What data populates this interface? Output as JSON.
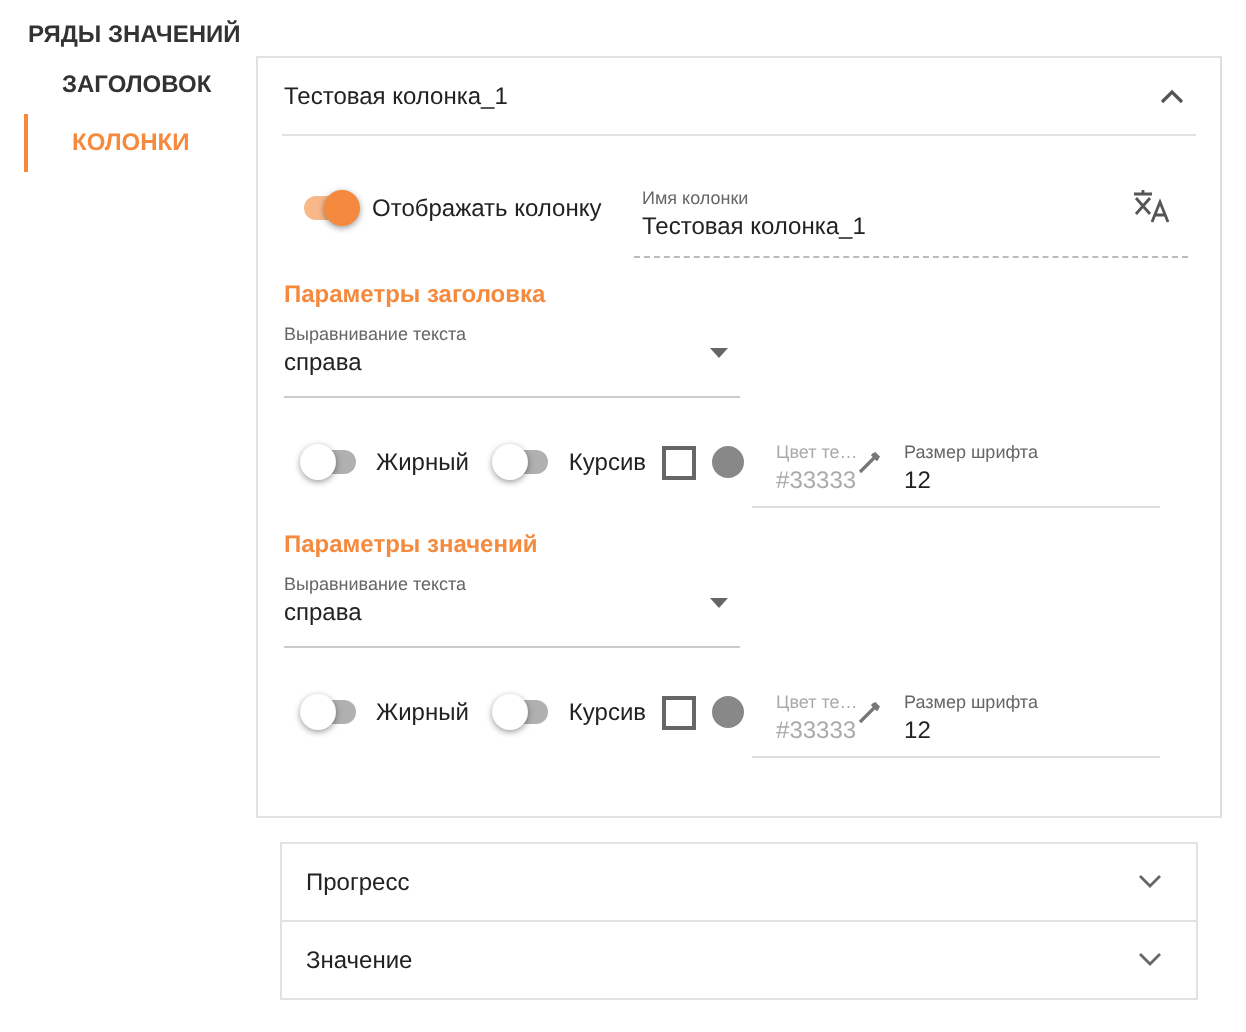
{
  "sidebar": {
    "title": "РЯДЫ ЗНАЧЕНИЙ",
    "items": [
      {
        "label": "ЗАГОЛОВОК",
        "selected": false
      },
      {
        "label": "КОЛОНКИ",
        "selected": true
      }
    ]
  },
  "column_panel": {
    "title": "Тестовая колонка_1",
    "expanded": true,
    "show_column": {
      "label": "Отображать колонку",
      "on": true
    },
    "name_field": {
      "label": "Имя колонки",
      "value": "Тестовая колонка_1"
    },
    "sections": [
      {
        "title": "Параметры заголовка",
        "align": {
          "label": "Выравнивание текста",
          "value": "справа"
        },
        "bold": {
          "label": "Жирный",
          "on": false
        },
        "italic": {
          "label": "Курсив",
          "on": false
        },
        "checkbox": {
          "checked": false
        },
        "color": {
          "label": "Цвет те…",
          "value": "#33333",
          "disabled": true
        },
        "font_size": {
          "label": "Размер шрифта",
          "value": "12"
        }
      },
      {
        "title": "Параметры значений",
        "align": {
          "label": "Выравнивание текста",
          "value": "справа"
        },
        "bold": {
          "label": "Жирный",
          "on": false
        },
        "italic": {
          "label": "Курсив",
          "on": false
        },
        "checkbox": {
          "checked": false
        },
        "color": {
          "label": "Цвет те…",
          "value": "#33333",
          "disabled": true
        },
        "font_size": {
          "label": "Размер шрифта",
          "value": "12"
        }
      }
    ]
  },
  "collapsed_panels": [
    {
      "title": "Прогресс",
      "expanded": false
    },
    {
      "title": "Значение",
      "expanded": false
    }
  ]
}
